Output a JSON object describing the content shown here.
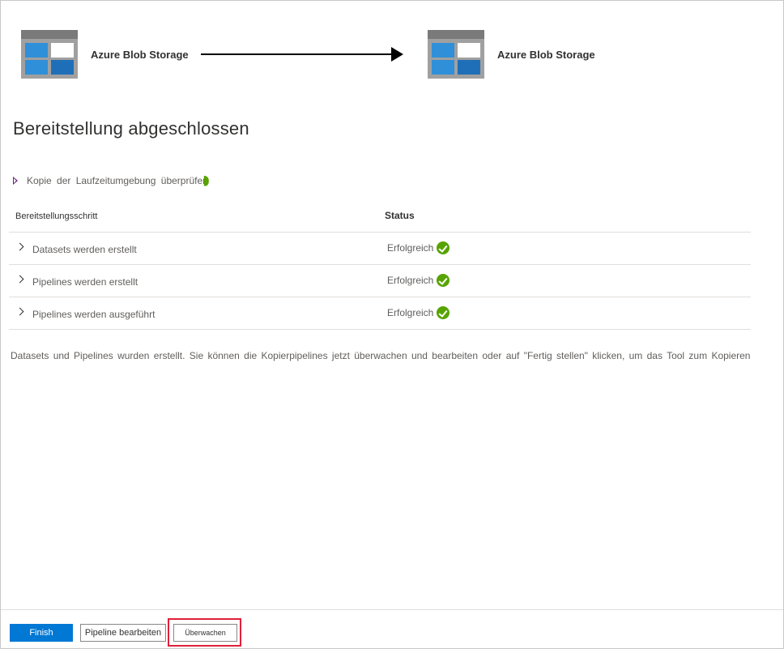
{
  "source": {
    "name": "Azure Blob Storage",
    "icon": "blob-storage-icon"
  },
  "destination": {
    "name": "Azure Blob Storage",
    "icon": "blob-storage-icon"
  },
  "page_title": "Bereitstellung abgeschlossen",
  "runtime_copy": {
    "label": "Kopie der Laufzeitumgebung überprüfen"
  },
  "table": {
    "headers": {
      "step": "Bereitstellungsschritt",
      "status": "Status"
    },
    "rows": [
      {
        "step": "Datasets werden erstellt",
        "status": "Erfolgreich"
      },
      {
        "step": "Pipelines werden erstellt",
        "status": "Erfolgreich"
      },
      {
        "step": "Pipelines werden ausgeführt",
        "status": "Erfolgreich"
      }
    ]
  },
  "message": "Datasets und Pipelines wurden erstellt. Sie können die Kopierpipelines jetzt überwachen und bearbeiten oder auf \"Fertig stellen\" klicken, um das Tool zum Kopieren",
  "buttons": {
    "finish": "Finish",
    "edit_pipeline": "Pipeline bearbeiten",
    "monitor": "Überwachen"
  },
  "colors": {
    "primary": "#0078d4",
    "success": "#57a300",
    "highlight": "#e0203a",
    "storage_blue": "#2f8fd8",
    "storage_frame": "#8a8a8a"
  }
}
